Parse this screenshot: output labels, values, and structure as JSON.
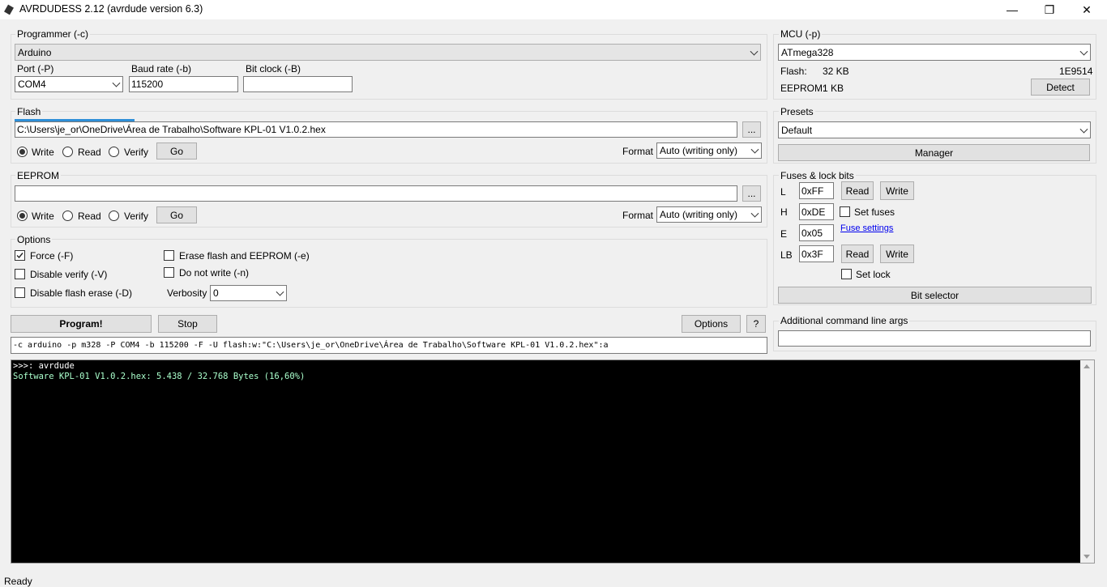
{
  "window": {
    "title": "AVRDUDESS 2.12 (avrdude version 6.3)",
    "minimize": "—",
    "maximize": "❐",
    "close": "✕"
  },
  "programmer": {
    "group_label": "Programmer (-c)",
    "selected": "Arduino",
    "port_label": "Port (-P)",
    "port": "COM4",
    "baud_label": "Baud rate (-b)",
    "baud": "115200",
    "bitclock_label": "Bit clock (-B)",
    "bitclock": ""
  },
  "mcu": {
    "group_label": "MCU (-p)",
    "selected": "ATmega328",
    "flash_label": "Flash:",
    "flash_size": "32 KB",
    "signature": "1E9514",
    "eeprom_label": "EEPROM:",
    "eeprom_size": "1 KB",
    "detect": "Detect"
  },
  "flash": {
    "group_label": "Flash",
    "path": "C:\\Users\\je_or\\OneDrive\\Área de Trabalho\\Software KPL-01 V1.0.2.hex",
    "browse": "...",
    "write": "Write",
    "read": "Read",
    "verify": "Verify",
    "selected_op": "Write",
    "go": "Go",
    "format_label": "Format",
    "format": "Auto (writing only)",
    "progress": 0.16
  },
  "eeprom": {
    "group_label": "EEPROM",
    "path": "",
    "browse": "...",
    "write": "Write",
    "read": "Read",
    "verify": "Verify",
    "selected_op": "Write",
    "go": "Go",
    "format_label": "Format",
    "format": "Auto (writing only)"
  },
  "presets": {
    "group_label": "Presets",
    "selected": "Default",
    "manager": "Manager"
  },
  "fuses": {
    "group_label": "Fuses & lock bits",
    "l_label": "L",
    "l_value": "0xFF",
    "h_label": "H",
    "h_value": "0xDE",
    "e_label": "E",
    "e_value": "0x05",
    "lb_label": "LB",
    "lb_value": "0x3F",
    "read": "Read",
    "write": "Write",
    "set_fuses": "Set fuses",
    "fuse_settings": "Fuse settings",
    "set_lock": "Set lock",
    "bit_selector": "Bit selector"
  },
  "options": {
    "group_label": "Options",
    "force": "Force (-F)",
    "force_checked": true,
    "disable_verify": "Disable verify (-V)",
    "disable_flash_erase": "Disable flash erase (-D)",
    "erase_flash": "Erase flash and EEPROM (-e)",
    "do_not_write": "Do not write (-n)",
    "verbosity_label": "Verbosity",
    "verbosity": "0"
  },
  "actions": {
    "program": "Program!",
    "stop": "Stop",
    "options": "Options",
    "help": "?"
  },
  "cmdline": "-c arduino -p m328 -P COM4 -b 115200 -F -U flash:w:\"C:\\Users\\je_or\\OneDrive\\Área de Trabalho\\Software KPL-01 V1.0.2.hex\":a",
  "additional": {
    "group_label": "Additional command line args",
    "value": ""
  },
  "console": {
    "line1": ">>>: avrdude",
    "line2": "Software KPL-01 V1.0.2.hex: 5.438 / 32.768 Bytes (16,60%)",
    "line1_color": "#ffffff",
    "line2_color": "#aaffcc"
  },
  "status": "Ready",
  "colors": {
    "progress": "#2e8fd8",
    "link": "#0000ee"
  }
}
